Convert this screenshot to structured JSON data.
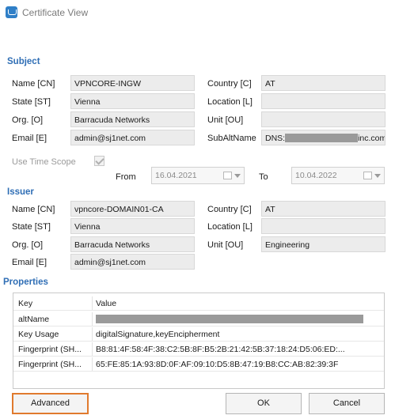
{
  "window": {
    "title": "Certificate View"
  },
  "subject": {
    "heading": "Subject",
    "cn_label": "Name [CN]",
    "cn_value": "VPNCORE-INGW",
    "st_label": "State [ST]",
    "st_value": "Vienna",
    "o_label": "Org. [O]",
    "o_value": "Barracuda Networks",
    "e_label": "Email [E]",
    "e_value": "admin@sj1net.com",
    "c_label": "Country [C]",
    "c_value": "AT",
    "l_label": "Location [L]",
    "l_value": "",
    "ou_label": "Unit [OU]",
    "ou_value": "",
    "san_label": "SubAltName",
    "san_prefix": "DNS:",
    "san_suffix": "inc.com"
  },
  "timescope": {
    "label": "Use Time Scope",
    "checked": true,
    "from_label": "From",
    "from_value": "16.04.2021",
    "to_label": "To",
    "to_value": "10.04.2022"
  },
  "issuer": {
    "heading": "Issuer",
    "cn_label": "Name [CN]",
    "cn_value": "vpncore-DOMAIN01-CA",
    "st_label": "State [ST]",
    "st_value": "Vienna",
    "o_label": "Org. [O]",
    "o_value": "Barracuda Networks",
    "e_label": "Email [E]",
    "e_value": "admin@sj1net.com",
    "c_label": "Country [C]",
    "c_value": "AT",
    "l_label": "Location [L]",
    "l_value": "",
    "ou_label": "Unit [OU]",
    "ou_value": "Engineering"
  },
  "properties": {
    "heading": "Properties",
    "col_key": "Key",
    "col_value": "Value",
    "rows": [
      {
        "key": "altName",
        "value": ""
      },
      {
        "key": "Key Usage",
        "value": "digitalSignature,keyEncipherment"
      },
      {
        "key": "Fingerprint (SH...",
        "value": "B8:81:4F:58:4F:38:C2:5B:8F:B5:2B:21:42:5B:37:18:24:D5:06:ED:..."
      },
      {
        "key": "Fingerprint (SH...",
        "value": "65:FE:85:1A:93:8D:0F:AF:09:10:D5:8B:47:19:B8:CC:AB:82:39:3F"
      }
    ]
  },
  "buttons": {
    "advanced": "Advanced",
    "ok": "OK",
    "cancel": "Cancel"
  },
  "colors": {
    "section_heading": "#2f6eb5",
    "focus_border": "#e07a2e",
    "field_bg": "#ececec"
  }
}
